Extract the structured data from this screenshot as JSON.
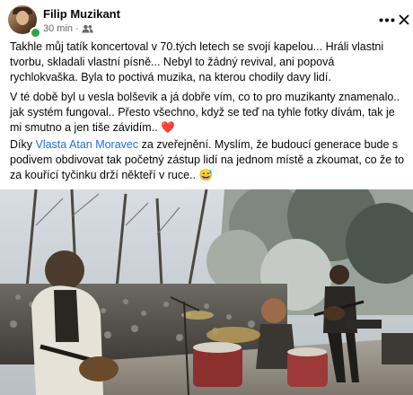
{
  "post": {
    "author": "Filip Muzikant",
    "time": "30 min",
    "separator": "·",
    "audience_icon": "friends-icon",
    "more_icon": "more-options-icon",
    "close_icon": "close-icon",
    "p1": "Takhle můj tatík koncertoval v 70.tých letech se svojí kapelou... Hráli vlastni tvorbu, skladali vlastní písně... Nebyl to žádný revival, ani popová rychlokvaška. Byla to poctivá muzika, na kterou chodily davy lidí.",
    "p2": "V té době byl u vesla bolševik a já dobře vím, co to pro muzikanty znamenalo.. jak systém fungoval.. Přesto všechno, když se teď na tyhle fotky dívám, tak je mi smutno a jen tiše závidím.. ",
    "p2_emoji": "❤️",
    "p3_before": "Díky ",
    "p3_tag": "Vlasta Atan Moravec",
    "p3_after": " za zveřejnění. Myslím, že budoucí generace bude s podivem obdivovat tak početný zástup lidí na jednom místě a zkoumat, co že to za kouřící tyčinku drží někteří v ruce.. ",
    "p3_emoji": "😅"
  },
  "colors": {
    "link": "#216fdb",
    "meta": "#65676b",
    "online": "#31a24c"
  }
}
